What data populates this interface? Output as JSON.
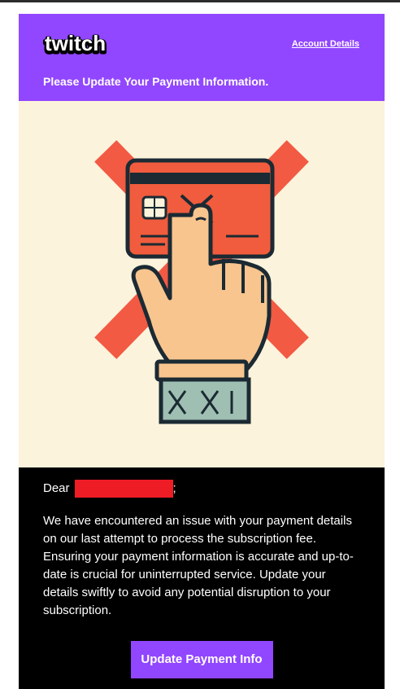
{
  "header": {
    "logo_text": "twitch",
    "account_link": "Account Details",
    "title": "Please Update Your Payment Information."
  },
  "body": {
    "greeting_prefix": "Dear",
    "greeting_suffix": ";",
    "paragraph": "We have encountered an issue with your payment details on our last attempt to process the subscription fee. Ensuring your payment information is accurate and up-to-date is crucial for uninterrupted service. Update your details swiftly to avoid any potential disruption to your subscription.",
    "cta_label": "Update Payment Info"
  },
  "colors": {
    "brand": "#9146ff",
    "hero_bg": "#fcf3dc",
    "card": "#f05c3d",
    "redaction": "#ee1c25"
  },
  "icons": [
    "credit-card-icon",
    "cross-x-icon",
    "hand-icon"
  ]
}
